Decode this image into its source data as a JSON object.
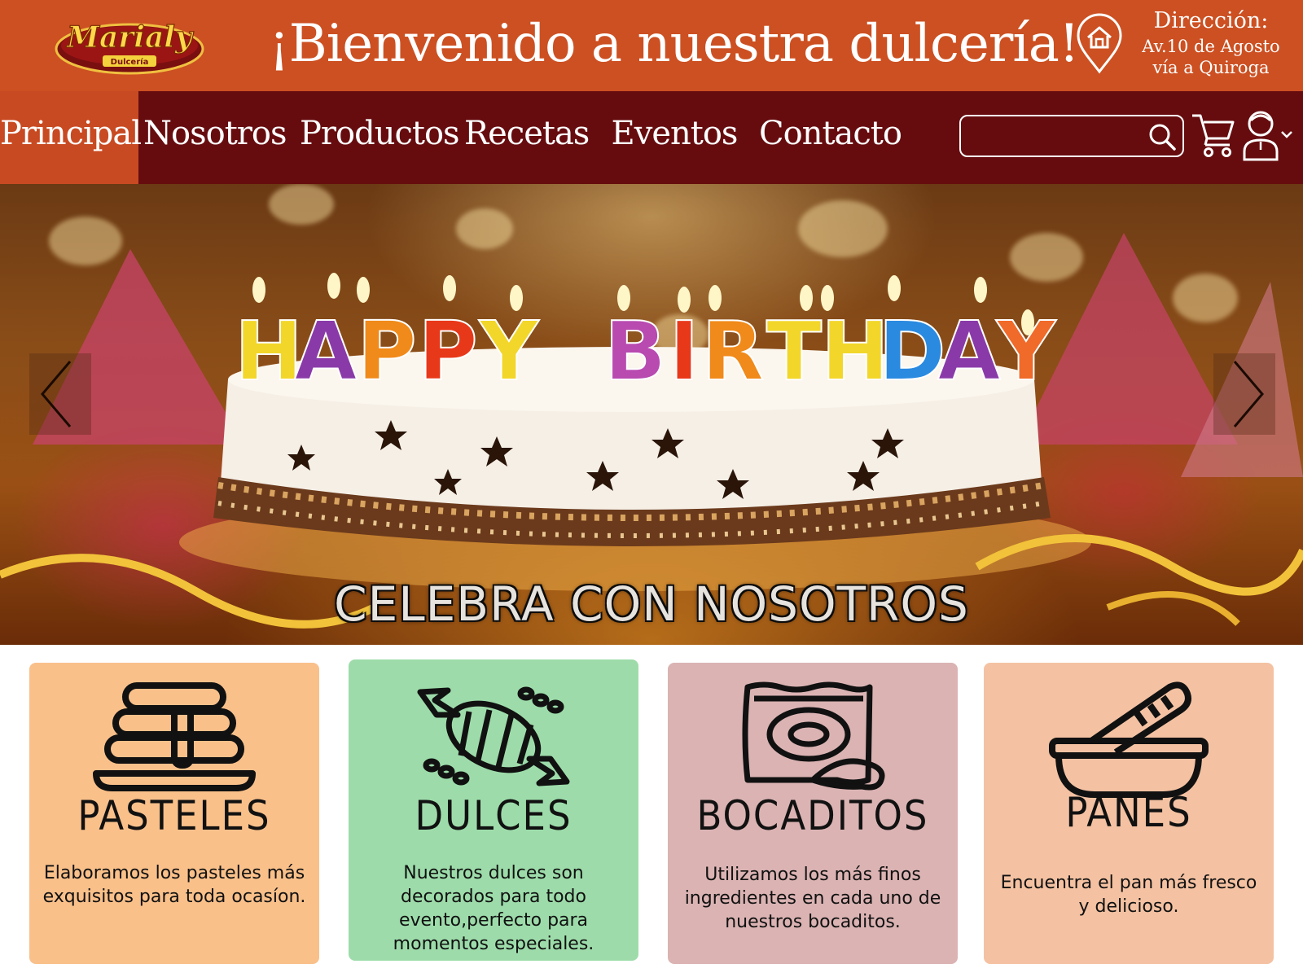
{
  "brand": {
    "logo_text": "Marialy",
    "logo_subtext": "Dulcería"
  },
  "header": {
    "welcome": "¡Bienvenido a nuestra dulcería!",
    "address": {
      "title": "Dirección:",
      "line1": "Av.10 de Agosto",
      "line2": "vía a Quiroga"
    },
    "colors": {
      "background": "#cc5022",
      "text": "#ffffff"
    }
  },
  "nav": {
    "items": [
      {
        "label": "Principal",
        "active": true
      },
      {
        "label": "Nosotros",
        "active": false
      },
      {
        "label": "Productos",
        "active": false
      },
      {
        "label": "Recetas",
        "active": false
      },
      {
        "label": "Eventos",
        "active": false
      },
      {
        "label": "Contacto",
        "active": false
      }
    ],
    "search": {
      "value": "",
      "placeholder": "",
      "icon": "search-icon"
    },
    "cart_icon": "cart-icon",
    "user_icon": "user-icon",
    "colors": {
      "background": "#660c0f",
      "active": "#c84a22"
    }
  },
  "hero": {
    "candle_text": "HAPPY BIRTHDAY",
    "caption": "CELEBRA CON NOSOTROS",
    "prev_icon": "chevron-left-icon",
    "next_icon": "chevron-right-icon"
  },
  "cards": [
    {
      "title": "PASTELES",
      "description": "Elaboramos los pasteles más exquisitos para toda ocasíon.",
      "icon": "pancake-stack-icon",
      "color": "#f9c08a"
    },
    {
      "title": "DULCES",
      "description": "Nuestros dulces son decorados para todo evento,perfecto para momentos especiales.",
      "icon": "candy-icon",
      "color": "#9ddcaa"
    },
    {
      "title": "BOCADITOS",
      "description": "Utilizamos los más finos ingredientes en cada uno de nuestros  bocaditos.",
      "icon": "chips-bag-icon",
      "color": "#dbb3b3"
    },
    {
      "title": "PANES",
      "description": "Encuentra el pan más fresco y delicioso.",
      "icon": "bread-basket-icon",
      "color": "#f4c2a2"
    }
  ]
}
